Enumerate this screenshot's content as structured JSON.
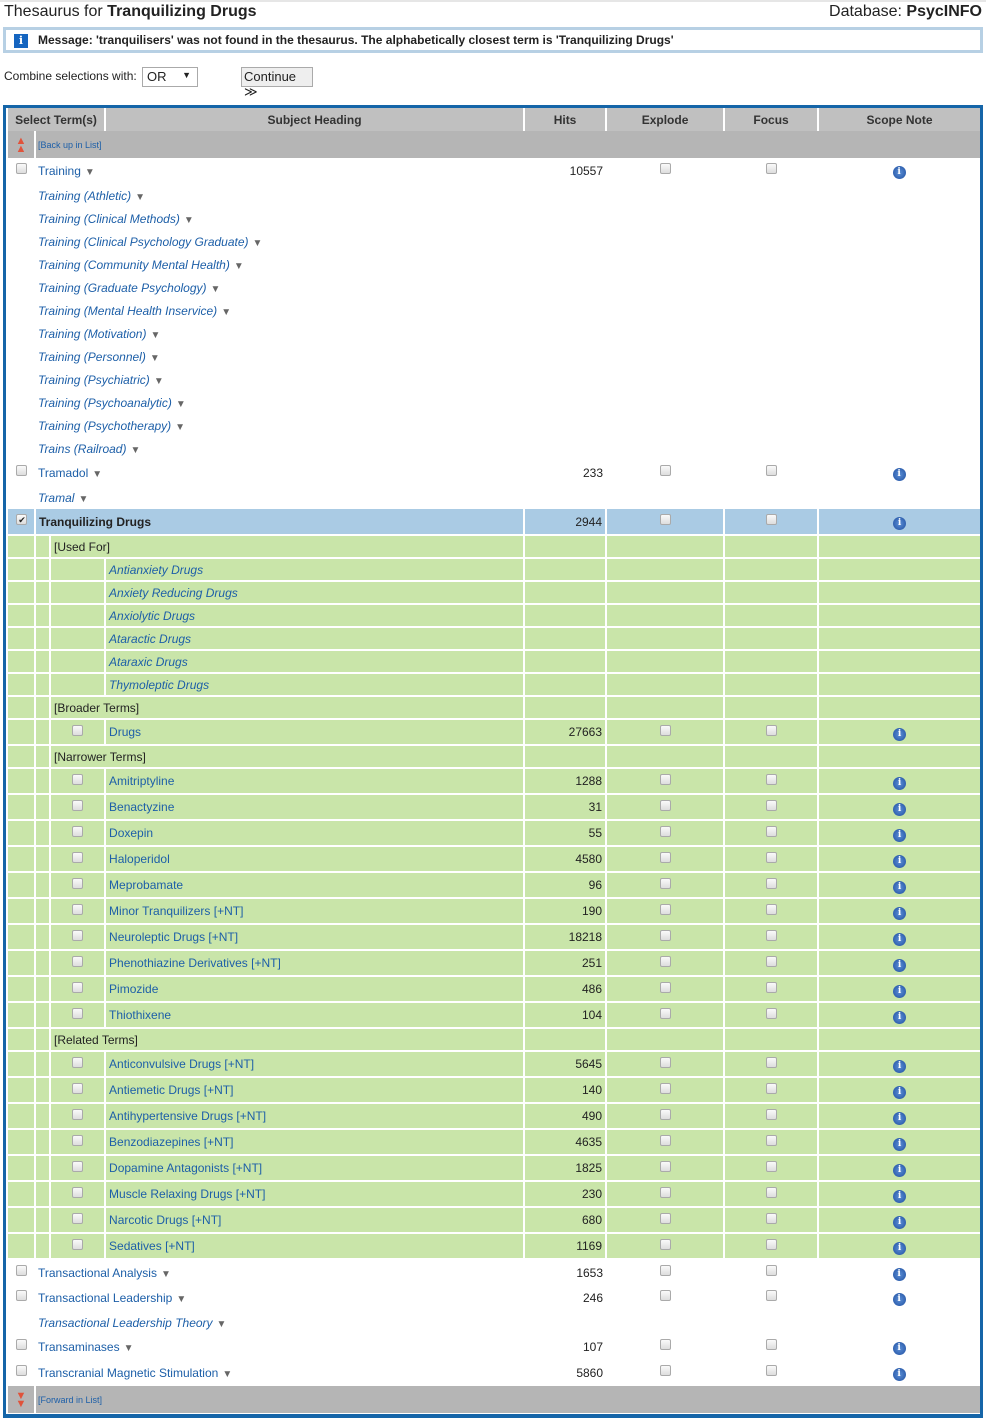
{
  "header": {
    "title_prefix": "Thesaurus for",
    "title_term": "Tranquilizing Drugs",
    "db_label": "Database:",
    "db_name": "PsycINFO"
  },
  "message": {
    "icon": "info-icon",
    "text": "Message: 'tranquilisers' was not found in the thesaurus. The alphabetically closest term is 'Tranquilizing Drugs'"
  },
  "combine": {
    "label": "Combine selections with:",
    "value": "OR",
    "continue_label": "Continue ≫"
  },
  "table": {
    "columns": [
      "Select Term(s)",
      "Subject Heading",
      "Hits",
      "Explode",
      "Focus",
      "Scope Note"
    ],
    "back_label": "[Back up in List]",
    "forward_label": "[Forward in List]",
    "rows": [
      {
        "type": "term",
        "label": "Training",
        "hits": "10557"
      },
      {
        "type": "alt",
        "label": "Training (Athletic)"
      },
      {
        "type": "alt",
        "label": "Training (Clinical Methods)"
      },
      {
        "type": "alt",
        "label": "Training (Clinical Psychology Graduate)"
      },
      {
        "type": "alt",
        "label": "Training (Community Mental Health)"
      },
      {
        "type": "alt",
        "label": "Training (Graduate Psychology)"
      },
      {
        "type": "alt",
        "label": "Training (Mental Health Inservice)"
      },
      {
        "type": "alt",
        "label": "Training (Motivation)"
      },
      {
        "type": "alt",
        "label": "Training (Personnel)"
      },
      {
        "type": "alt",
        "label": "Training (Psychiatric)"
      },
      {
        "type": "alt",
        "label": "Training (Psychoanalytic)"
      },
      {
        "type": "alt",
        "label": "Training (Psychotherapy)"
      },
      {
        "type": "alt",
        "label": "Trains (Railroad)"
      },
      {
        "type": "term",
        "label": "Tramadol",
        "hits": "233"
      },
      {
        "type": "alt",
        "label": "Tramal"
      },
      {
        "type": "selected",
        "label": "Tranquilizing Drugs",
        "hits": "2944",
        "checked": true
      },
      {
        "type": "section",
        "label": "[Used For]"
      },
      {
        "type": "uf",
        "label": "Antianxiety Drugs"
      },
      {
        "type": "uf",
        "label": "Anxiety Reducing Drugs"
      },
      {
        "type": "uf",
        "label": "Anxiolytic Drugs"
      },
      {
        "type": "uf",
        "label": "Ataractic Drugs"
      },
      {
        "type": "uf",
        "label": "Ataraxic Drugs"
      },
      {
        "type": "uf",
        "label": "Thymoleptic Drugs"
      },
      {
        "type": "section",
        "label": "[Broader Terms]"
      },
      {
        "type": "rel",
        "label": "Drugs",
        "hits": "27663"
      },
      {
        "type": "section",
        "label": "[Narrower Terms]"
      },
      {
        "type": "rel",
        "label": "Amitriptyline",
        "hits": "1288"
      },
      {
        "type": "rel",
        "label": "Benactyzine",
        "hits": "31"
      },
      {
        "type": "rel",
        "label": "Doxepin",
        "hits": "55"
      },
      {
        "type": "rel",
        "label": "Haloperidol",
        "hits": "4580"
      },
      {
        "type": "rel",
        "label": "Meprobamate",
        "hits": "96"
      },
      {
        "type": "rel",
        "label": "Minor Tranquilizers [+NT]",
        "hits": "190"
      },
      {
        "type": "rel",
        "label": "Neuroleptic Drugs [+NT]",
        "hits": "18218"
      },
      {
        "type": "rel",
        "label": "Phenothiazine Derivatives [+NT]",
        "hits": "251"
      },
      {
        "type": "rel",
        "label": "Pimozide",
        "hits": "486"
      },
      {
        "type": "rel",
        "label": "Thiothixene",
        "hits": "104"
      },
      {
        "type": "section",
        "label": "[Related Terms]"
      },
      {
        "type": "rel",
        "label": "Anticonvulsive Drugs [+NT]",
        "hits": "5645"
      },
      {
        "type": "rel",
        "label": "Antiemetic Drugs [+NT]",
        "hits": "140"
      },
      {
        "type": "rel",
        "label": "Antihypertensive Drugs [+NT]",
        "hits": "490"
      },
      {
        "type": "rel",
        "label": "Benzodiazepines [+NT]",
        "hits": "4635"
      },
      {
        "type": "rel",
        "label": "Dopamine Antagonists [+NT]",
        "hits": "1825"
      },
      {
        "type": "rel",
        "label": "Muscle Relaxing Drugs [+NT]",
        "hits": "230"
      },
      {
        "type": "rel",
        "label": "Narcotic Drugs [+NT]",
        "hits": "680"
      },
      {
        "type": "rel",
        "label": "Sedatives [+NT]",
        "hits": "1169"
      },
      {
        "type": "term",
        "label": "Transactional Analysis",
        "hits": "1653"
      },
      {
        "type": "term",
        "label": "Transactional Leadership",
        "hits": "246"
      },
      {
        "type": "alt",
        "label": "Transactional Leadership Theory"
      },
      {
        "type": "term",
        "label": "Transaminases",
        "hits": "107"
      },
      {
        "type": "term",
        "label": "Transcranial Magnetic Stimulation",
        "hits": "5860"
      }
    ]
  },
  "colors": {
    "accent": "#1565a8",
    "selected_row": "#aacbe4",
    "related_rows": "#c9e5a9",
    "link": "#1d5fa8"
  }
}
